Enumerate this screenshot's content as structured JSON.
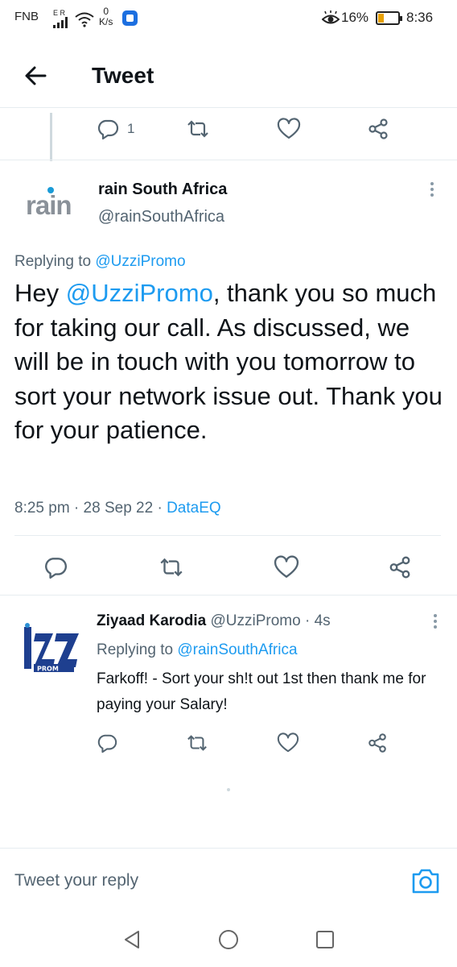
{
  "status_bar": {
    "carrier": "FNB",
    "signal_label": "E R",
    "net_speed_value": "0",
    "net_speed_unit": "K/s",
    "battery_percent": "16%",
    "time": "8:36",
    "icons": [
      "signal-icon",
      "wifi-icon",
      "app-notification-icon",
      "eye-comfort-icon",
      "battery-icon"
    ],
    "battery_color": "#e8a000"
  },
  "header": {
    "back_icon": "arrow-left-icon",
    "title": "Tweet"
  },
  "parent_tweet_actions": {
    "reply_count": "1"
  },
  "main_tweet": {
    "avatar_text": "rain",
    "author_name": "rain South Africa",
    "author_handle": "@rainSouthAfrica",
    "replying_prefix": "Replying to",
    "replying_handle": "@UzziPromo",
    "text_prefix": "Hey",
    "text_mention": "@UzziPromo",
    "text_body": ", thank you so much for taking our call. As discussed, we will be in touch with you tomorrow to sort your network issue out. Thank you for your patience.",
    "time": "8:25 pm",
    "date": "28 Sep 22",
    "source": "DataEQ"
  },
  "reply_tweet": {
    "author_name": "Ziyaad Karodia",
    "author_handle": "@UzziPromo",
    "age": "4s",
    "replying_prefix": "Replying to",
    "replying_handle": "@rainSouthAfrica",
    "text": "Farkoff! - Sort your sh!t out 1st then thank me for paying your Salary!"
  },
  "composer": {
    "placeholder": "Tweet your reply",
    "camera_icon": "camera-icon"
  },
  "colors": {
    "accent": "#1d9bf0",
    "text_primary": "#0f1419",
    "text_secondary": "#536471",
    "icon_gray": "#536471",
    "divider": "#e6ecf0"
  }
}
